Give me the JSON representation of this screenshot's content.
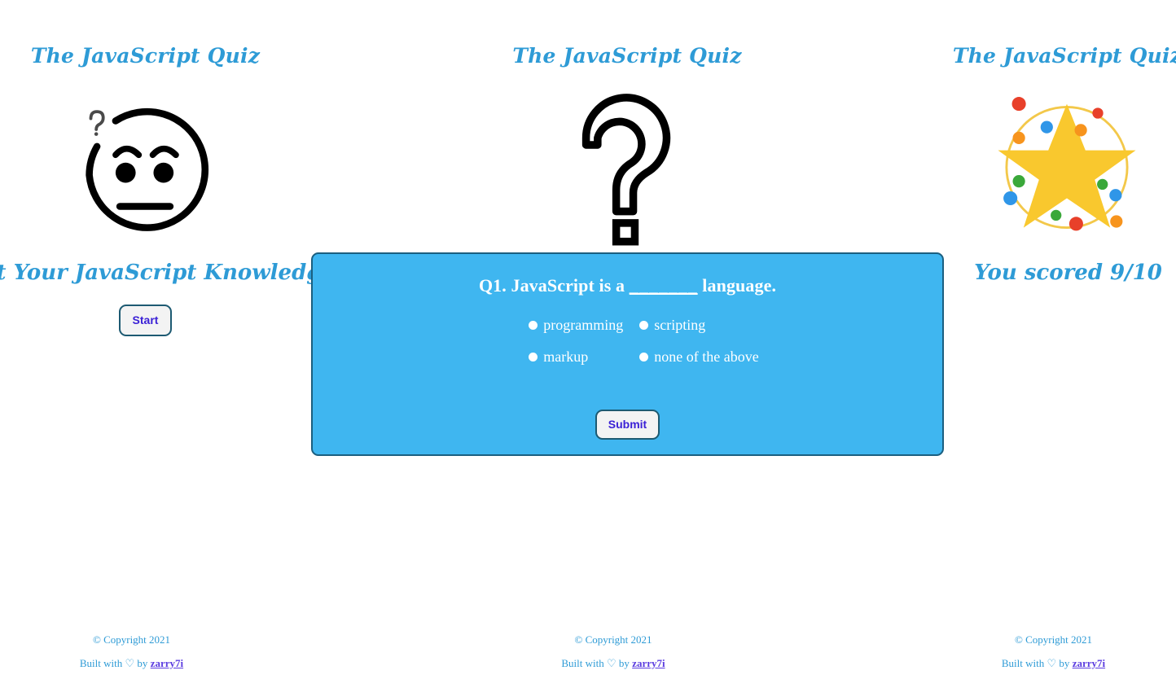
{
  "app": {
    "title": "The JavaScript Quiz",
    "accent_blue": "#2e9bd6",
    "panel_blue": "#3fb6f0",
    "panel_border": "#1b5f80",
    "button_text": "#3b21d6",
    "link_purple": "#5b3ce0"
  },
  "start_screen": {
    "title": "The JavaScript Quiz",
    "hero_icon": "confused-face-icon",
    "tagline": "Test Your JavaScript Knowledge",
    "start_label": "Start"
  },
  "quiz_screen": {
    "title": "The JavaScript Quiz",
    "hero_icon": "question-mark-icon",
    "question": {
      "prefix": "Q1. JavaScript is a",
      "blank": "_______",
      "suffix": "language.",
      "full_text": "Q1. JavaScript is a _______ language."
    },
    "options": [
      {
        "label": "programming",
        "selected": false
      },
      {
        "label": "scripting",
        "selected": false
      },
      {
        "label": "markup",
        "selected": false
      },
      {
        "label": "none of the above",
        "selected": false
      }
    ],
    "submit_label": "Submit"
  },
  "result_screen": {
    "title": "The JavaScript Quiz",
    "hero_icon": "star-confetti-icon",
    "score_text": "You scored 9/10",
    "score": 9,
    "total": 10,
    "star_color": "#f9c82e",
    "confetti_colors": [
      "#e8402a",
      "#2f96e8",
      "#f7941d",
      "#3aa83a"
    ]
  },
  "footer": {
    "copyright": "© Copyright 2021",
    "built_prefix": "Built with",
    "heart": "♡",
    "built_middle": "by",
    "author": "zarry7i"
  }
}
